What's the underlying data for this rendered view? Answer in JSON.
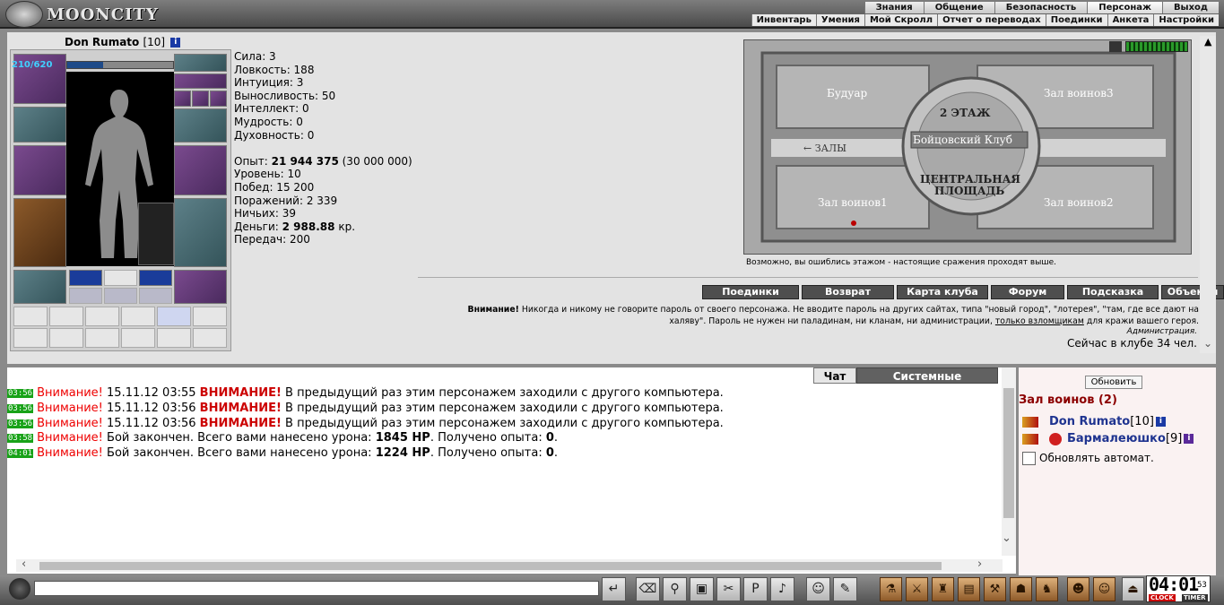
{
  "app": {
    "logo": "MOONCITY"
  },
  "menu_top": [
    "Знания",
    "Общение",
    "Безопасность",
    "Персонаж",
    "Выход"
  ],
  "menu_sub": [
    "Инвентарь",
    "Умения",
    "Мой Скролл",
    "Отчет о переводах",
    "Поединки",
    "Анкета",
    "Настройки"
  ],
  "character": {
    "name": "Don Rumato",
    "level": "[10]",
    "hp_text": "210/620",
    "hp_fraction": 0.34,
    "info_icon": "i"
  },
  "stats": {
    "strength": "Сила: 3",
    "agility": "Ловкость: 188",
    "intuition": "Интуиция: 3",
    "endurance": "Выносливость: 50",
    "intellect": "Интеллект: 0",
    "wisdom": "Мудрость: 0",
    "spirit": "Духовность: 0",
    "exp_label": "Опыт:",
    "exp_value": "21 944 375",
    "exp_next": "(30 000 000)",
    "level": "Уровень: 10",
    "wins": "Побед: 15 200",
    "losses": "Поражений: 2 339",
    "draws": "Ничьих: 39",
    "money_label": "Деньги:",
    "money_value": "2 988.88",
    "money_unit": "кр.",
    "transfers": "Передач: 200"
  },
  "map": {
    "labels": {
      "boudoir": "Будуар",
      "hall3": "Зал воинов3",
      "floor": "2 ЭТАЖ",
      "club": "Бойцовский Клуб",
      "halls": "← ЗАЛЫ",
      "square1": "ЦЕНТРАЛЬНАЯ",
      "square2": "ПЛОЩАДЬ",
      "hall1": "Зал воинов1",
      "hall2": "Зал воинов2"
    },
    "note": "Возможно, вы ошиблись этажом - настоящие сражения проходят выше."
  },
  "buttons": [
    "Поединки",
    "Возврат",
    "Карта клуба",
    "Форум",
    "Подсказка",
    "Объекты"
  ],
  "warning": {
    "title": "Внимание!",
    "text1": " Никогда и никому не говорите пароль от своего персонажа. Не вводите пароль на других сайтах, типа \"новый город\", \"лотерея\", \"там, где все дают на",
    "text2a": "халяву\". Пароль не нужен ни паладинам, ни кланам, ни администрации, ",
    "text2link": "только взломщикам",
    "text2b": " для кражи вашего героя.",
    "signature": "Администрация.",
    "online": "Сейчас в клубе 34 чел."
  },
  "chat": {
    "tabs": [
      "Чат",
      "Системные сообщения"
    ],
    "lines": [
      {
        "time": "03:56",
        "attn": "Внимание!",
        "date": " 15.11.12 03:55 ",
        "bold": "ВНИМАНИЕ!",
        "text": " В предыдущий раз этим персонажем заходили с другого компьютера."
      },
      {
        "time": "03:56",
        "attn": "Внимание!",
        "date": " 15.11.12 03:56 ",
        "bold": "ВНИМАНИЕ!",
        "text": " В предыдущий раз этим персонажем заходили с другого компьютера."
      },
      {
        "time": "03:56",
        "attn": "Внимание!",
        "date": " 15.11.12 03:56 ",
        "bold": "ВНИМАНИЕ!",
        "text": " В предыдущий раз этим персонажем заходили с другого компьютера."
      },
      {
        "time": "03:58",
        "attn": "Внимание!",
        "t1": " Бой закончен. Всего вами нанесено урона: ",
        "dmg": "1845 HP",
        "t2": ". Получено опыта: ",
        "exp": "0",
        "t3": "."
      },
      {
        "time": "04:01",
        "attn": "Внимание!",
        "t1": " Бой закончен. Всего вами нанесено урона: ",
        "dmg": "1224 HP",
        "t2": ". Получено опыта: ",
        "exp": "0",
        "t3": "."
      }
    ]
  },
  "room": {
    "refresh": "Обновить",
    "title": "Зал воинов (2)",
    "players": [
      {
        "name": "Don Rumato",
        "level": "[10]"
      },
      {
        "name": "Бармалеюшко",
        "level": "[9]"
      }
    ],
    "auto_refresh": "Обновлять автомат."
  },
  "clock": {
    "time": "04:01",
    "sec": "53",
    "clock_label": "CLOCK",
    "timer_label": "TIMER"
  },
  "colors": {
    "accent_red": "#e00000",
    "player_blue": "#1f3490",
    "room_title": "#8c0000",
    "time_green": "#18a218"
  }
}
